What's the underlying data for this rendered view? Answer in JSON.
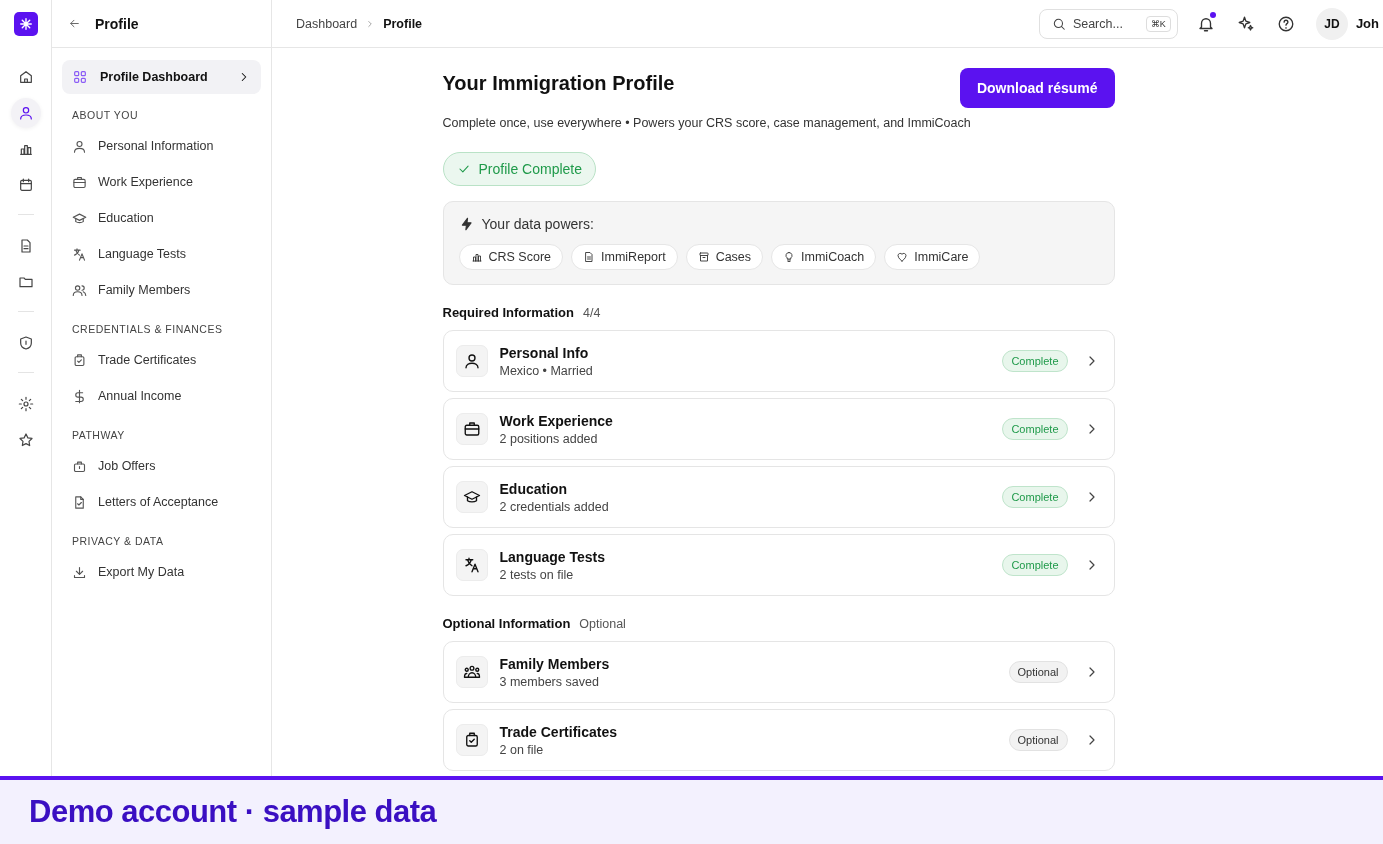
{
  "rail": {
    "items": [
      {
        "selected": false
      },
      {
        "selected": true
      },
      {
        "selected": false
      },
      {
        "selected": false
      },
      {
        "selected": false
      },
      {
        "selected": false
      },
      {
        "selected": false
      },
      {
        "selected": false
      },
      {
        "selected": false
      }
    ]
  },
  "sidebar": {
    "title": "Profile",
    "dashboard": {
      "label": "Profile Dashboard",
      "selected": true
    },
    "sections": [
      {
        "heading": "ABOUT YOU",
        "items": [
          "Personal Information",
          "Work Experience",
          "Education",
          "Language Tests",
          "Family Members"
        ]
      },
      {
        "heading": "CREDENTIALS & FINANCES",
        "items": [
          "Trade Certificates",
          "Annual Income"
        ]
      },
      {
        "heading": "PATHWAY",
        "items": [
          "Job Offers",
          "Letters of Acceptance"
        ]
      },
      {
        "heading": "PRIVACY & DATA",
        "items": [
          "Export My Data"
        ]
      }
    ]
  },
  "topbar": {
    "breadcrumb": [
      "Dashboard",
      "Profile"
    ],
    "search": {
      "placeholder": "Search...",
      "shortcut": "⌘K"
    },
    "notifications": {
      "unread": true
    },
    "avatar": "JD",
    "user_name": "Joh"
  },
  "header": {
    "title": "Your Immigration Profile",
    "button": "Download résumé",
    "subtitle": "Complete once, use everywhere • Powers your CRS score, case management, and ImmiCoach"
  },
  "status": {
    "label": "Profile Complete"
  },
  "powers": {
    "label": "Your data powers:",
    "chips": [
      "CRS Score",
      "ImmiReport",
      "Cases",
      "ImmiCoach",
      "ImmiCare"
    ]
  },
  "sections": [
    {
      "title": "Required Information",
      "count": "4/4",
      "cards": [
        {
          "title": "Personal Info",
          "subtitle": "Mexico • Married",
          "badge": "Complete",
          "kind": "complete"
        },
        {
          "title": "Work Experience",
          "subtitle": "2 positions added",
          "badge": "Complete",
          "kind": "complete"
        },
        {
          "title": "Education",
          "subtitle": "2 credentials added",
          "badge": "Complete",
          "kind": "complete"
        },
        {
          "title": "Language Tests",
          "subtitle": "2 tests on file",
          "badge": "Complete",
          "kind": "complete"
        }
      ]
    },
    {
      "title": "Optional Information",
      "count": "Optional",
      "cards": [
        {
          "title": "Family Members",
          "subtitle": "3 members saved",
          "badge": "Optional",
          "kind": "optional"
        },
        {
          "title": "Trade Certificates",
          "subtitle": "2 on file",
          "badge": "Optional",
          "kind": "optional"
        }
      ]
    }
  ],
  "banner": {
    "text": "Demo account · sample data"
  }
}
